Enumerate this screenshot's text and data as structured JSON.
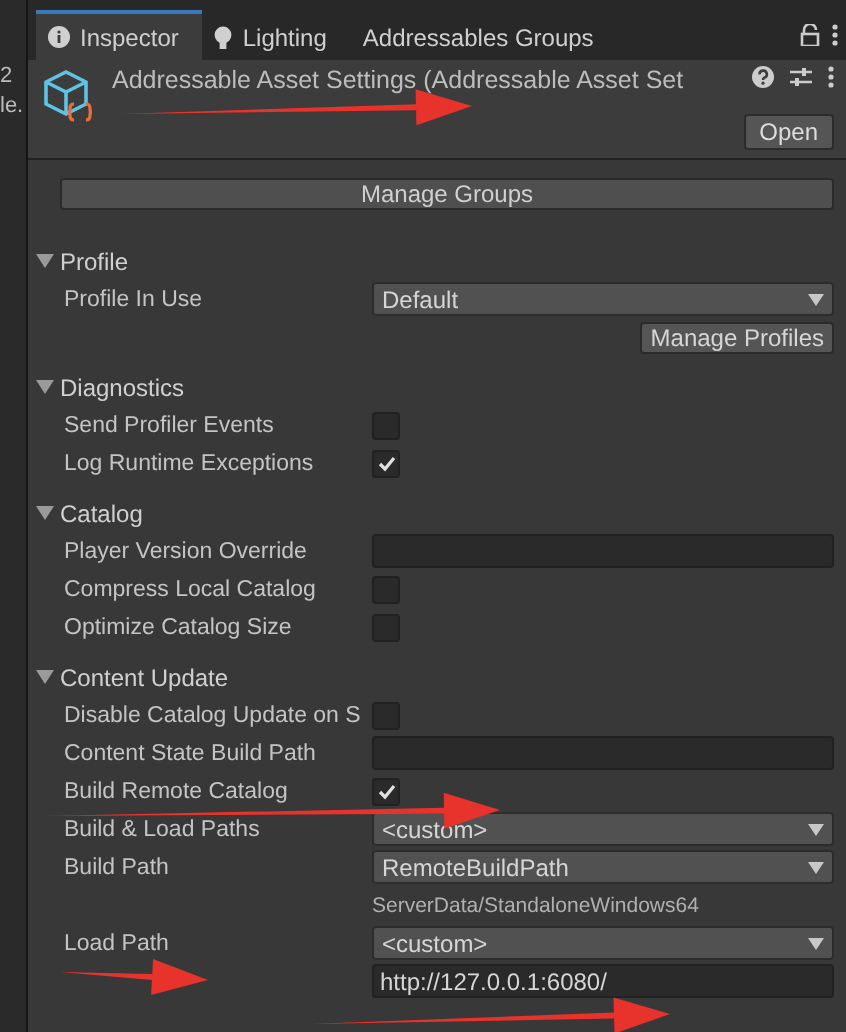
{
  "side_panel": {
    "texts": [
      "2",
      "le."
    ]
  },
  "tabs": [
    {
      "label": "Inspector",
      "selected": true
    },
    {
      "label": "Lighting",
      "selected": false
    },
    {
      "label": "Addressables Groups",
      "selected": false
    }
  ],
  "header": {
    "title": "Addressable Asset Settings (Addressable Asset Set",
    "open_button": "Open"
  },
  "manage_groups_button": "Manage Groups",
  "sections": [
    {
      "title": "Profile",
      "expanded": true,
      "rows": [
        {
          "kind": "dropdown",
          "label": "Profile In Use",
          "value": "Default"
        },
        {
          "kind": "button",
          "label": "Manage Profiles"
        }
      ]
    },
    {
      "title": "Diagnostics",
      "expanded": true,
      "rows": [
        {
          "kind": "checkbox",
          "label": "Send Profiler Events",
          "checked": false
        },
        {
          "kind": "checkbox",
          "label": "Log Runtime Exceptions",
          "checked": true
        }
      ]
    },
    {
      "title": "Catalog",
      "expanded": true,
      "rows": [
        {
          "kind": "text",
          "label": "Player Version Override"
        },
        {
          "kind": "checkbox",
          "label": "Compress Local Catalog",
          "checked": false
        },
        {
          "kind": "checkbox",
          "label": "Optimize Catalog Size",
          "checked": false
        }
      ]
    },
    {
      "title": "Content Update",
      "expanded": true,
      "rows": [
        {
          "kind": "checkbox",
          "label": "Disable Catalog Update on S",
          "checked": false
        },
        {
          "kind": "text",
          "label": "Content State Build Path"
        },
        {
          "kind": "checkbox",
          "label": "Build Remote Catalog",
          "checked": true
        },
        {
          "kind": "dropdown",
          "label": "Build & Load Paths",
          "value": "<custom>"
        },
        {
          "kind": "dropdown",
          "label": "Build Path",
          "value": "RemoteBuildPath"
        },
        {
          "kind": "note",
          "value": "ServerData/StandaloneWindows64"
        },
        {
          "kind": "dropdown",
          "label": "Load Path",
          "value": "<custom>"
        },
        {
          "kind": "text",
          "value": "http://127.0.0.1:6080/"
        }
      ]
    }
  ]
}
